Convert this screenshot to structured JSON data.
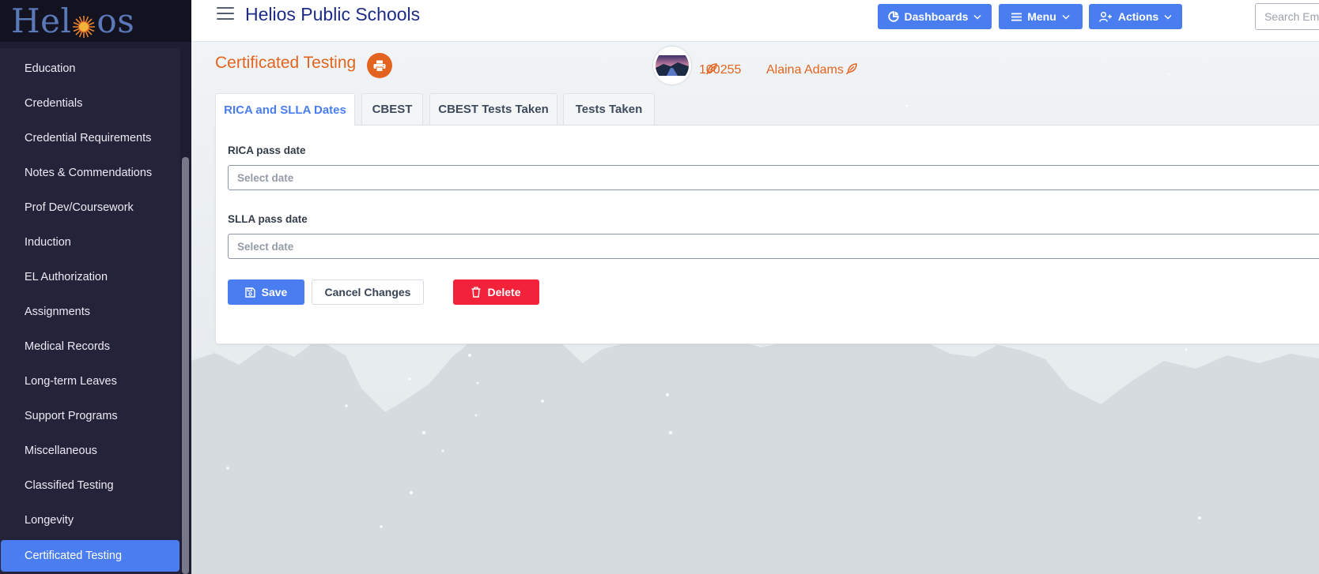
{
  "sidebar": {
    "logo": {
      "before": "Hel",
      "after": "os"
    },
    "items": [
      {
        "label": "Education"
      },
      {
        "label": "Credentials"
      },
      {
        "label": "Credential Requirements"
      },
      {
        "label": "Notes & Commendations"
      },
      {
        "label": "Prof Dev/Coursework"
      },
      {
        "label": "Induction"
      },
      {
        "label": "EL Authorization"
      },
      {
        "label": "Assignments"
      },
      {
        "label": "Medical Records"
      },
      {
        "label": "Long-term Leaves"
      },
      {
        "label": "Support Programs"
      },
      {
        "label": "Miscellaneous"
      },
      {
        "label": "Classified Testing"
      },
      {
        "label": "Longevity"
      },
      {
        "label": "Certificated Testing"
      }
    ],
    "active_item": "Certificated Testing"
  },
  "topbar": {
    "title": "Helios Public Schools",
    "dashboards_label": "Dashboards",
    "menu_label": "Menu",
    "actions_label": "Actions",
    "search_placeholder": "Search Employees"
  },
  "page": {
    "title": "Certificated Testing",
    "employee": {
      "id": "100255",
      "name": "Alaina Adams"
    }
  },
  "tabs": [
    {
      "label": "RICA and SLLA Dates",
      "active": true
    },
    {
      "label": "CBEST",
      "active": false
    },
    {
      "label": "CBEST Tests Taken",
      "active": false
    },
    {
      "label": "Tests Taken",
      "active": false
    }
  ],
  "form": {
    "rica_label": "RICA pass date",
    "rica_placeholder": "Select date",
    "slla_label": "SLLA pass date",
    "slla_placeholder": "Select date",
    "save_label": "Save",
    "cancel_label": "Cancel Changes",
    "delete_label": "Delete"
  },
  "colors": {
    "accent": "#4a7ef0",
    "brand_orange": "#e2641f",
    "danger": "#f2223a",
    "sidebar_bg": "#252339",
    "title_navy": "#1d2b86"
  },
  "icons": {
    "menu": "hamburger-icon",
    "dashboards": "pie-chart-icon",
    "menu_button": "list-icon",
    "actions": "user-plus-icon",
    "chevron": "chevron-down-icon",
    "print": "printer-icon",
    "edit": "feather-icon",
    "save": "floppy-disk-icon",
    "delete": "trash-icon"
  }
}
